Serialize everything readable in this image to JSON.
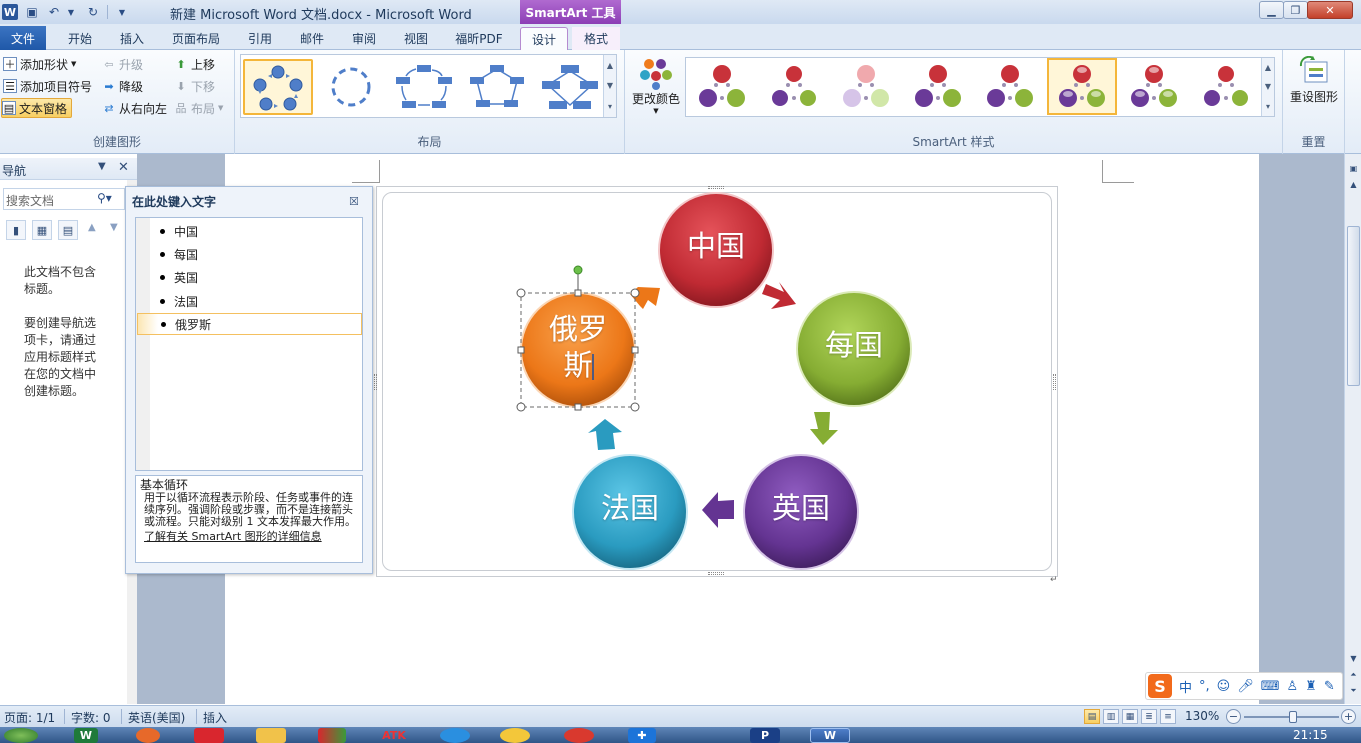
{
  "window": {
    "title": "新建 Microsoft Word 文档.docx  -  Microsoft Word",
    "app_logo": "W",
    "context_tool": "SmartArt 工具"
  },
  "tabs": {
    "file": "文件",
    "home": "开始",
    "insert": "插入",
    "page_layout": "页面布局",
    "references": "引用",
    "mailings": "邮件",
    "review": "审阅",
    "view": "视图",
    "foxit": "福昕PDF",
    "design": "设计",
    "format": "格式"
  },
  "ribbon": {
    "create_graphic": {
      "label": "创建图形",
      "add_shape": "添加形状",
      "add_bullet": "添加项目符号",
      "text_pane": "文本窗格",
      "promote": "升级",
      "demote": "降级",
      "right_to_left": "从右向左",
      "move_up": "上移",
      "move_down": "下移",
      "layout": "布局"
    },
    "layouts": {
      "label": "布局"
    },
    "styles": {
      "label": "SmartArt 样式",
      "change_colors": "更改颜色"
    },
    "reset": {
      "label": "重置",
      "reset_graphic": "重设图形"
    }
  },
  "nav_pane": {
    "title": "导航",
    "search_placeholder": "搜索文档",
    "message": "此文档不包含标题。\n\n要创建导航选项卡，请通过应用标题样式在您的文档中创建标题。"
  },
  "text_pane": {
    "title": "在此处键入文字",
    "items": [
      "中国",
      "每国",
      "英国",
      "法国",
      "俄罗斯"
    ],
    "selected_index": 4,
    "desc_title": "基本循环",
    "desc_body": "用于以循环流程表示阶段、任务或事件的连续序列。强调阶段或步骤，而不是连接箭头或流程。只能对级别 1 文本发挥最大作用。",
    "desc_link": "了解有关 SmartArt 图形的详细信息"
  },
  "smartart": {
    "nodes": [
      {
        "label": "中国",
        "color": "#c8323a"
      },
      {
        "label": "每国",
        "color": "#8cb43a"
      },
      {
        "label": "英国",
        "color": "#6a3a98"
      },
      {
        "label": "法国",
        "color": "#2ea3c6"
      },
      {
        "label": "俄罗\n斯",
        "color": "#ef7b1c"
      }
    ]
  },
  "status_bar": {
    "page": "页面: 1/1",
    "words": "字数: 0",
    "language": "英语(美国)",
    "mode": "插入",
    "zoom": "130%"
  },
  "taskbar": {
    "clock": "21:15",
    "atk": "ATK"
  }
}
